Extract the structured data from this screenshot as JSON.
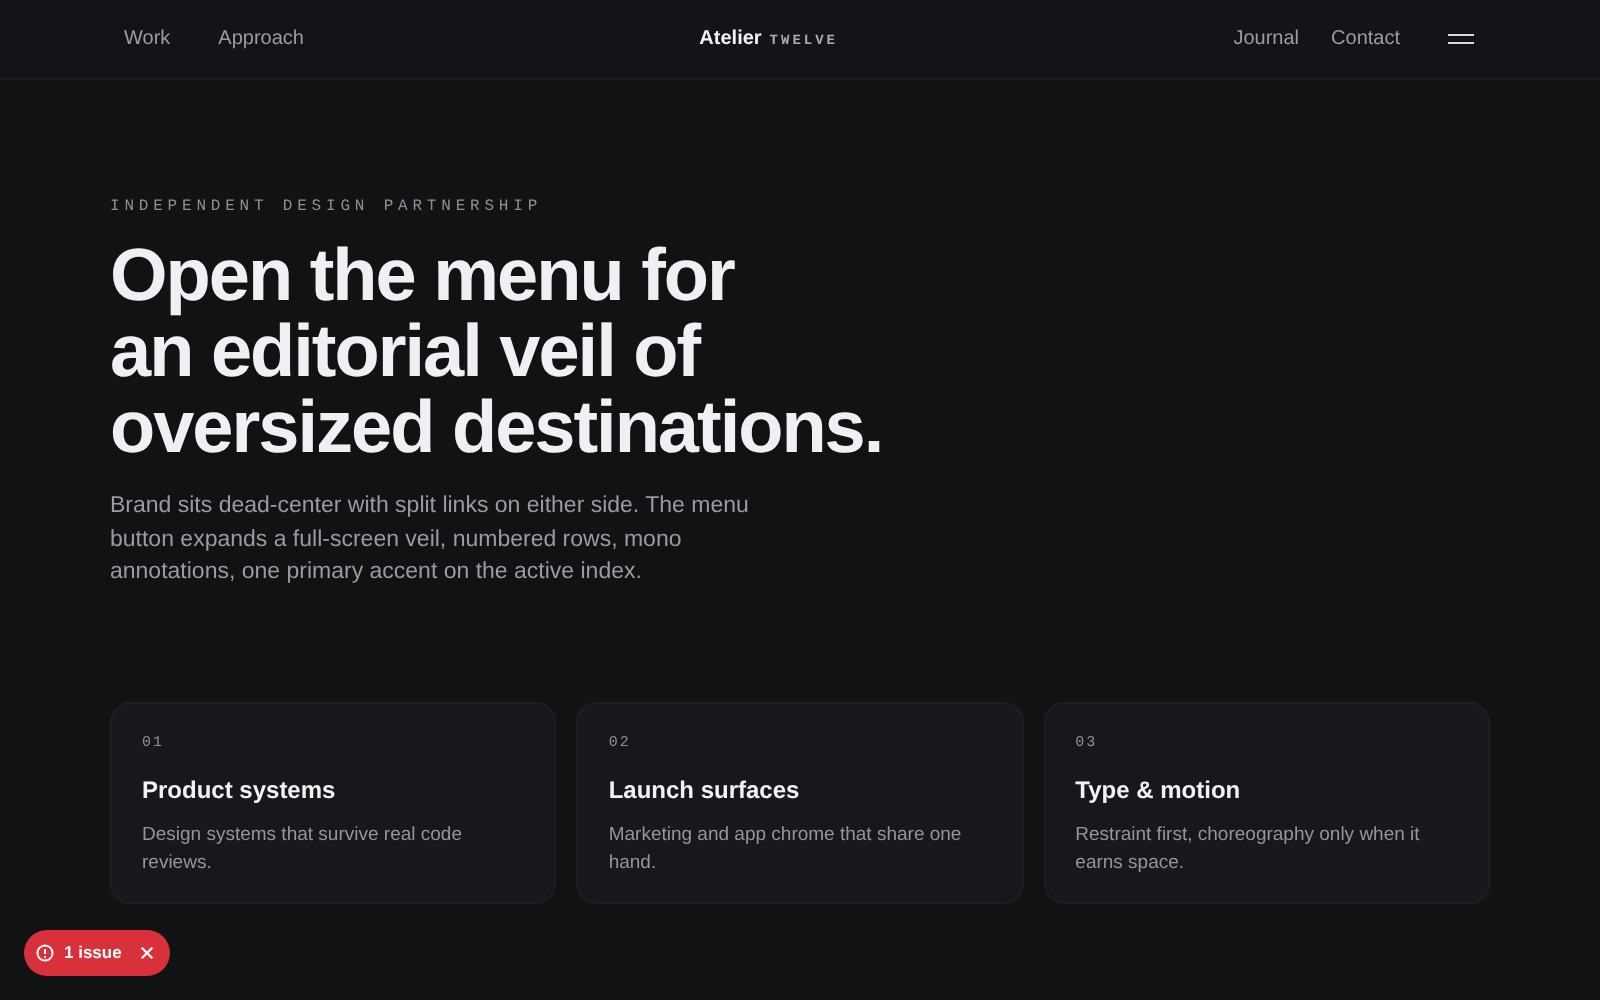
{
  "nav": {
    "left_links": [
      "Work",
      "Approach"
    ],
    "brand": "Atelier",
    "brand_suffix": "TWELVE",
    "right_links": [
      "Journal",
      "Contact"
    ]
  },
  "hero": {
    "eyebrow": "INDEPENDENT DESIGN PARTNERSHIP",
    "heading_lines": [
      "Open the menu for",
      "an editorial veil of",
      "oversized destinations."
    ],
    "body": "Brand sits dead-center with split links on either side. The menu button expands a full-screen veil, numbered rows, mono annotations, one primary accent on the active index."
  },
  "cards": [
    {
      "index": "01",
      "title": "Product systems",
      "text": "Design systems that survive real code reviews."
    },
    {
      "index": "02",
      "title": "Launch surfaces",
      "text": "Marketing and app chrome that share one hand."
    },
    {
      "index": "03",
      "title": "Type & motion",
      "text": "Restraint first, choreography only when it earns space."
    }
  ],
  "issues_badge": {
    "label": "1 issue"
  }
}
